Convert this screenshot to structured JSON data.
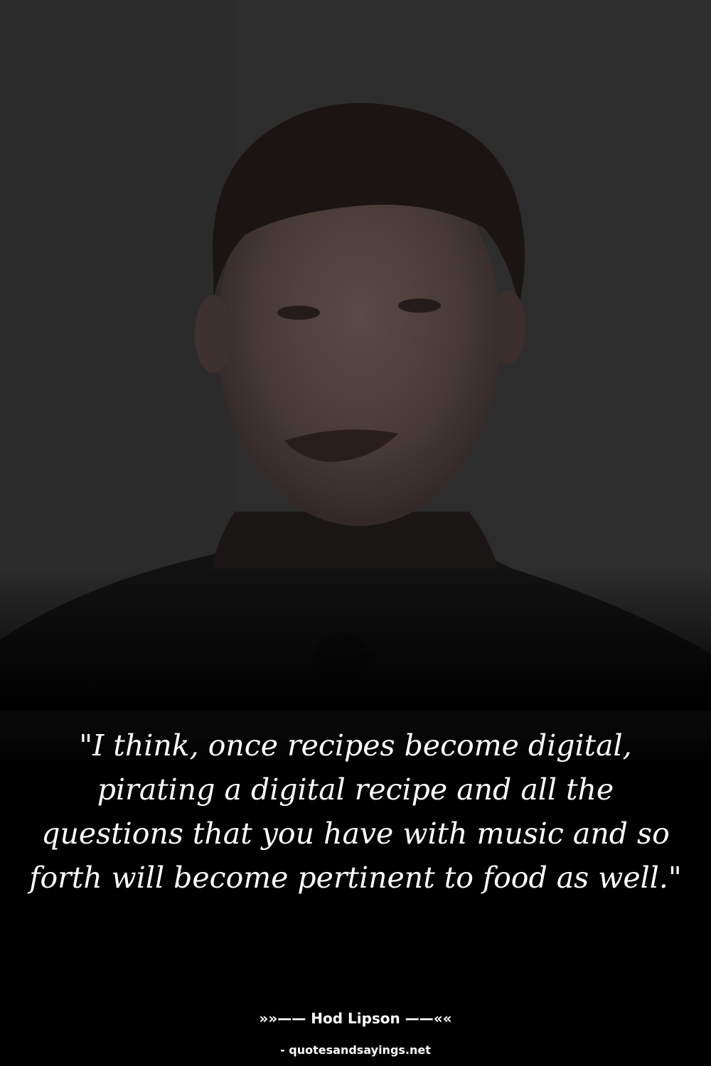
{
  "quote": {
    "text": "\"I think, once recipes become digital, pirating a digital recipe and all the questions that you have with music and so forth will become pertinent to food as well.\""
  },
  "author": {
    "line": "»»—— Hod Lipson ——««"
  },
  "source": {
    "label": "- quotesandsayings.net"
  },
  "colors": {
    "text": "#ffffff",
    "background": "#000000"
  }
}
